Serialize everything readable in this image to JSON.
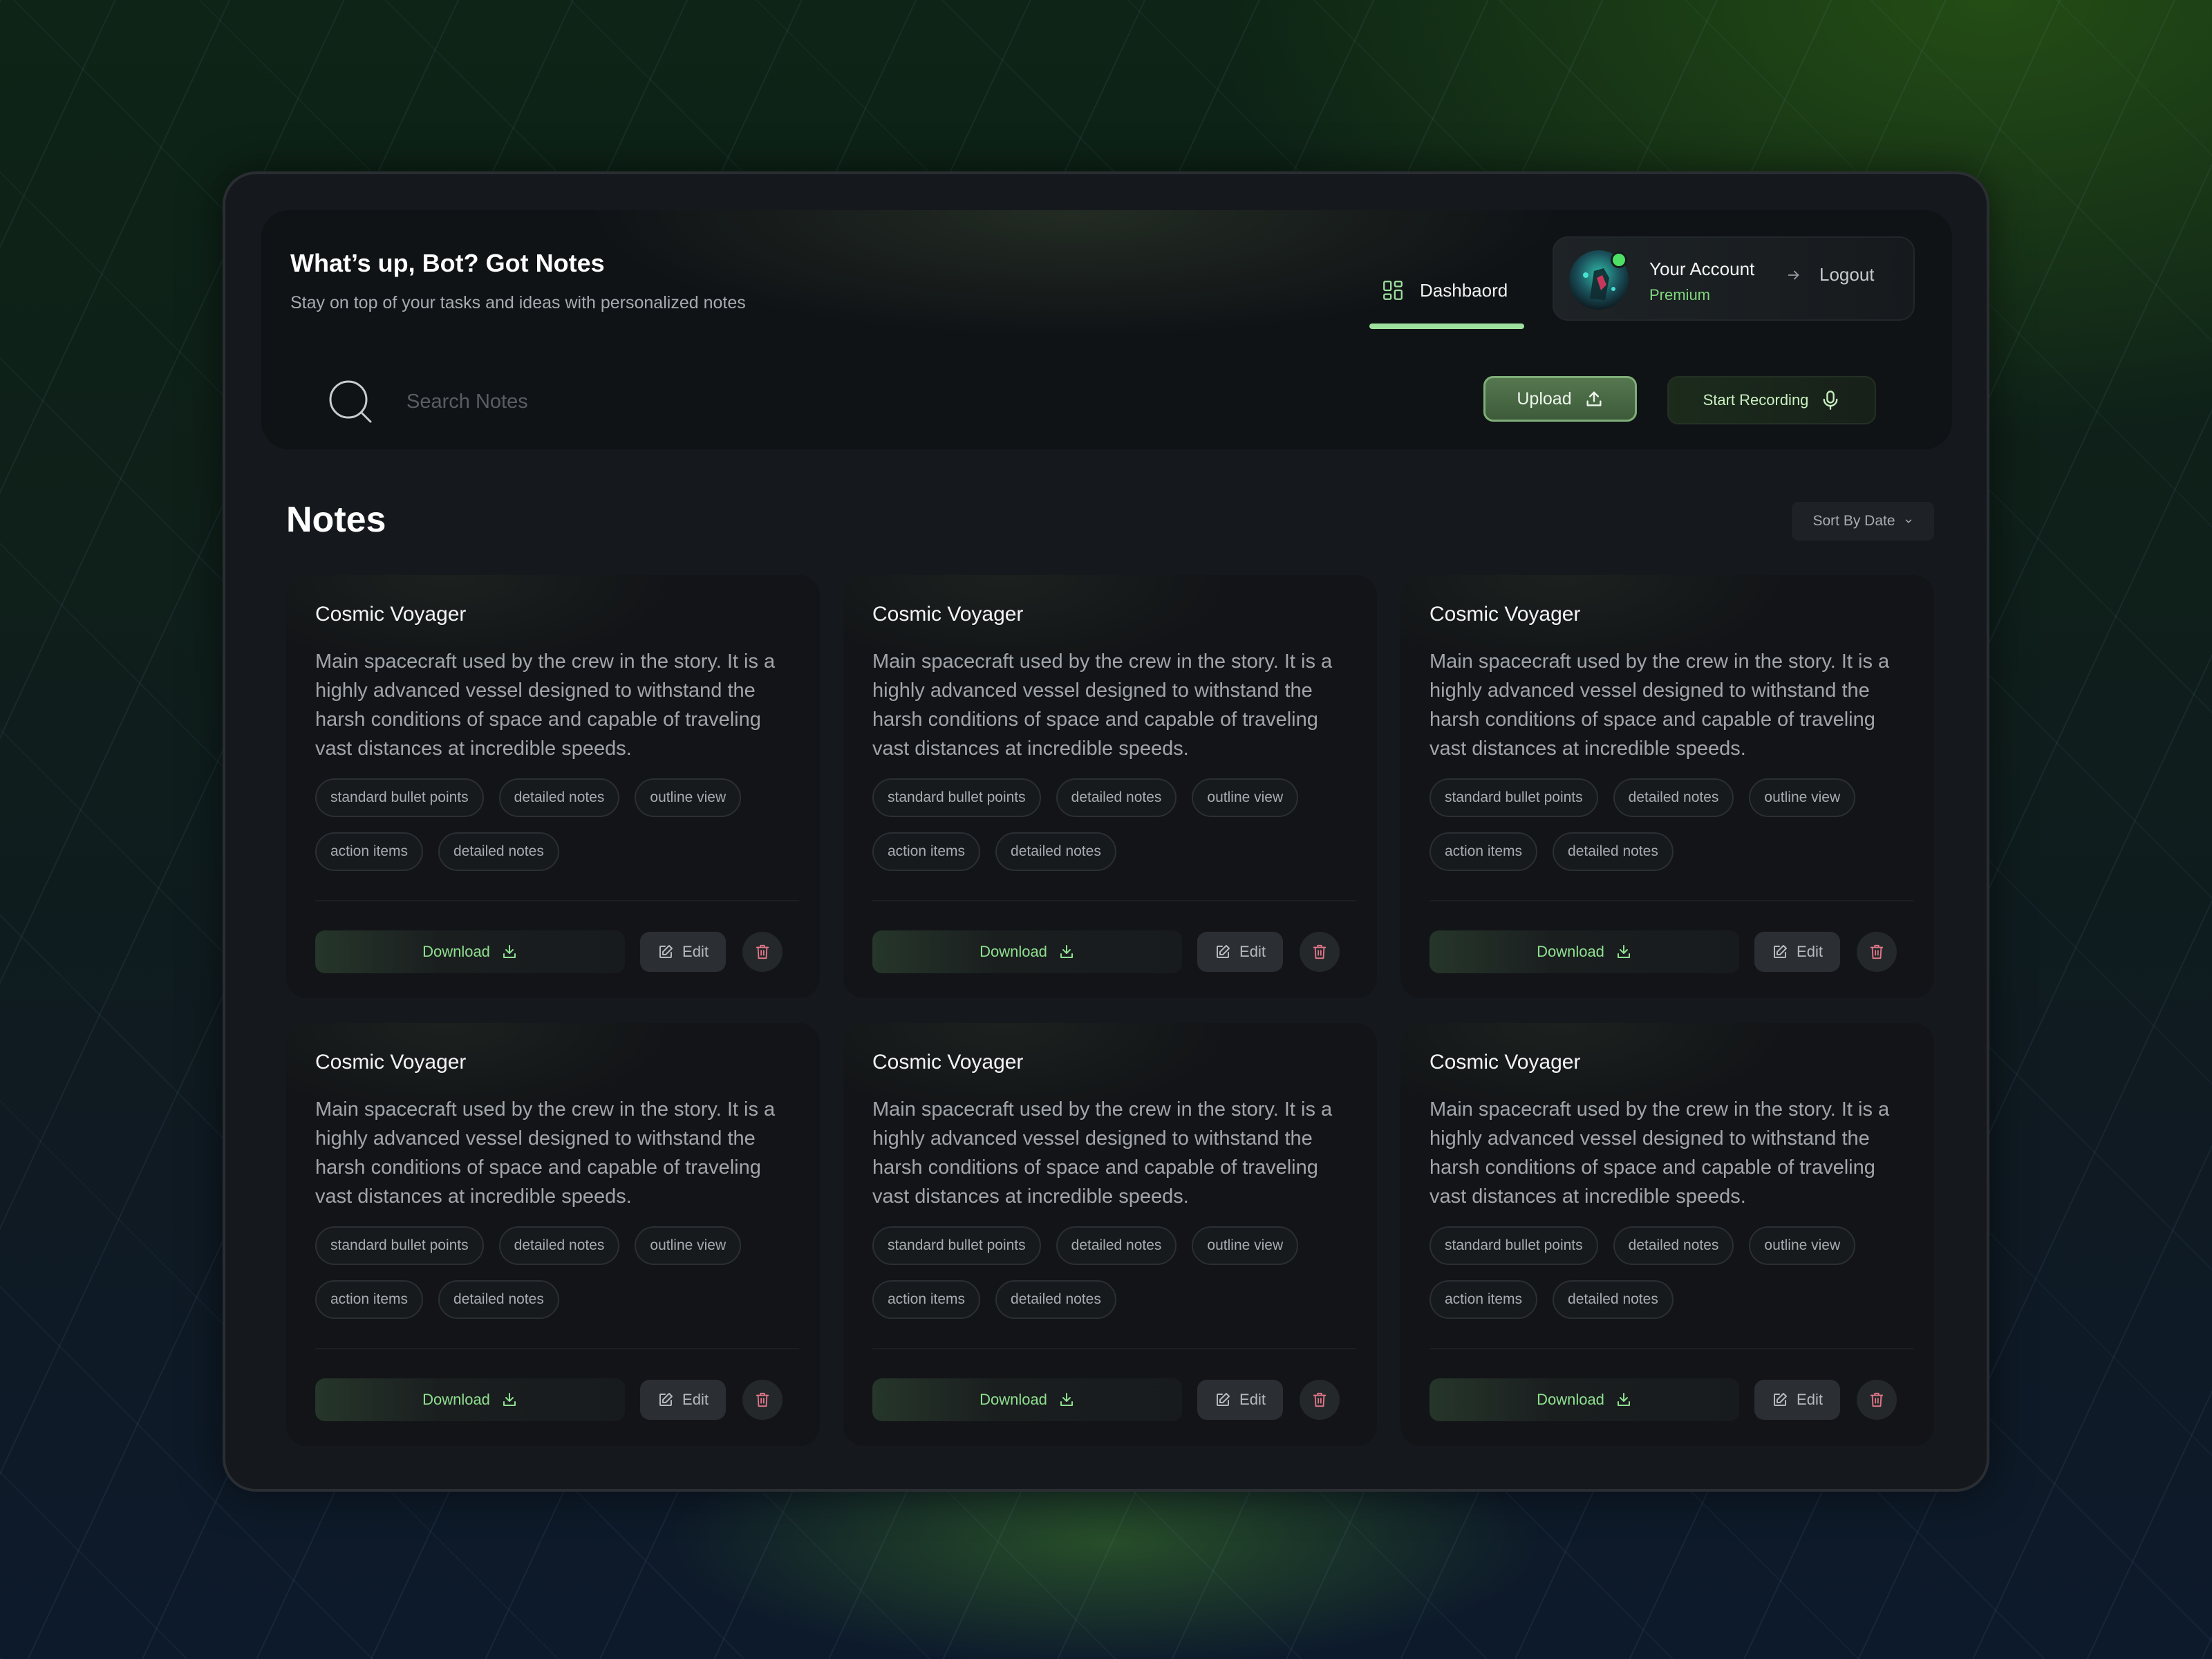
{
  "header": {
    "title": "What’s up, Bot? Got Notes",
    "subtitle": "Stay on top of your tasks and ideas with personalized notes",
    "nav_dashboard_label": "Dashbaord",
    "account_name": "Your Account",
    "account_tier": "Premium",
    "logout_label": "Logout",
    "search_placeholder": "Search Notes",
    "upload_label": "Upload",
    "record_label": "Start Recording"
  },
  "notes": {
    "title": "Notes",
    "sort_label": "Sort By Date",
    "cards": [
      {
        "title": "Cosmic Voyager",
        "description": "Main spacecraft used by the crew in the story. It is a highly advanced vessel designed to withstand the harsh conditions of space and capable of traveling vast distances at incredible speeds.",
        "tags": [
          "standard bullet points",
          "detailed notes",
          "outline view",
          "action items",
          "detailed notes"
        ],
        "download_label": "Download",
        "edit_label": "Edit"
      },
      {
        "title": "Cosmic Voyager",
        "description": "Main spacecraft used by the crew in the story. It is a highly advanced vessel designed to withstand the harsh conditions of space and capable of traveling vast distances at incredible speeds.",
        "tags": [
          "standard bullet points",
          "detailed notes",
          "outline view",
          "action items",
          "detailed notes"
        ],
        "download_label": "Download",
        "edit_label": "Edit"
      },
      {
        "title": "Cosmic Voyager",
        "description": "Main spacecraft used by the crew in the story. It is a highly advanced vessel designed to withstand the harsh conditions of space and capable of traveling vast distances at incredible speeds.",
        "tags": [
          "standard bullet points",
          "detailed notes",
          "outline view",
          "action items",
          "detailed notes"
        ],
        "download_label": "Download",
        "edit_label": "Edit"
      },
      {
        "title": "Cosmic Voyager",
        "description": "Main spacecraft used by the crew in the story. It is a highly advanced vessel designed to withstand the harsh conditions of space and capable of traveling vast distances at incredible speeds.",
        "tags": [
          "standard bullet points",
          "detailed notes",
          "outline view",
          "action items",
          "detailed notes"
        ],
        "download_label": "Download",
        "edit_label": "Edit"
      },
      {
        "title": "Cosmic Voyager",
        "description": "Main spacecraft used by the crew in the story. It is a highly advanced vessel designed to withstand the harsh conditions of space and capable of traveling vast distances at incredible speeds.",
        "tags": [
          "standard bullet points",
          "detailed notes",
          "outline view",
          "action items",
          "detailed notes"
        ],
        "download_label": "Download",
        "edit_label": "Edit"
      },
      {
        "title": "Cosmic Voyager",
        "description": "Main spacecraft used by the crew in the story. It is a highly advanced vessel designed to withstand the harsh conditions of space and capable of traveling vast distances at incredible speeds.",
        "tags": [
          "standard bullet points",
          "detailed notes",
          "outline view",
          "action items",
          "detailed notes"
        ],
        "download_label": "Download",
        "edit_label": "Edit"
      }
    ]
  },
  "icons": {
    "nav_dashboard": "dashboard-icon",
    "logout": "arrow-right-icon",
    "search": "search-icon",
    "upload": "upload-icon",
    "record": "microphone-icon",
    "sort": "chevron-down-icon",
    "download": "download-icon",
    "edit": "edit-icon",
    "delete": "trash-icon"
  },
  "colors": {
    "accent_green": "#9fe09f",
    "download_text": "#8fe08f",
    "delete_icon": "#e0788a",
    "status_online": "#4ee065",
    "panel_bg": "#15181c"
  }
}
